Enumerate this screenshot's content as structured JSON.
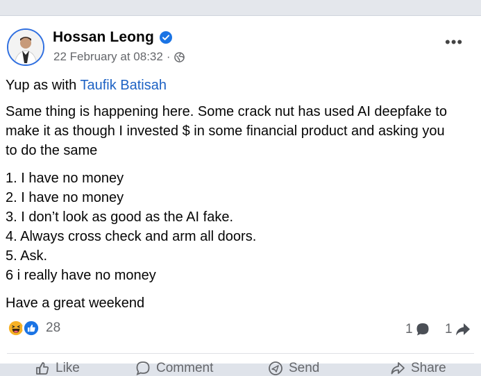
{
  "post": {
    "author": "Hossan Leong",
    "timestamp": "22 February at 08:32",
    "separator": "·",
    "more_label": "•••",
    "mention_prefix": "Yup as with ",
    "mention": "Taufik Batisah",
    "paragraph1_line1": "Same thing is happening here. Some crack nut has used AI deepfake to",
    "paragraph1_line2": "make it as though I invested $ in some financial product and asking you",
    "paragraph1_line3": "to do the same",
    "list": [
      "1. I have no money",
      "2. I have no money",
      "3. I don’t look as good as the AI fake.",
      "4. Always cross check and arm all doors.",
      "5. Ask.",
      "6  i really have no money"
    ],
    "closing": "Have a great weekend"
  },
  "footer": {
    "reaction_count": "28",
    "comment_count": "1",
    "share_count": "1",
    "actions": [
      "Like",
      "Comment",
      "Send",
      "Share"
    ]
  },
  "icons": {
    "verified": "verified-badge-icon",
    "audience": "globe-icon",
    "reactions": [
      "haha-reaction-icon",
      "like-reaction-icon"
    ],
    "comment": "comment-bubble-icon",
    "share": "share-arrow-icon"
  },
  "colors": {
    "accent": "#1d62c4",
    "verified": "#1b74e4",
    "meta_text": "#65676b",
    "haha": "#f7b125",
    "like": "#1b74e4"
  }
}
